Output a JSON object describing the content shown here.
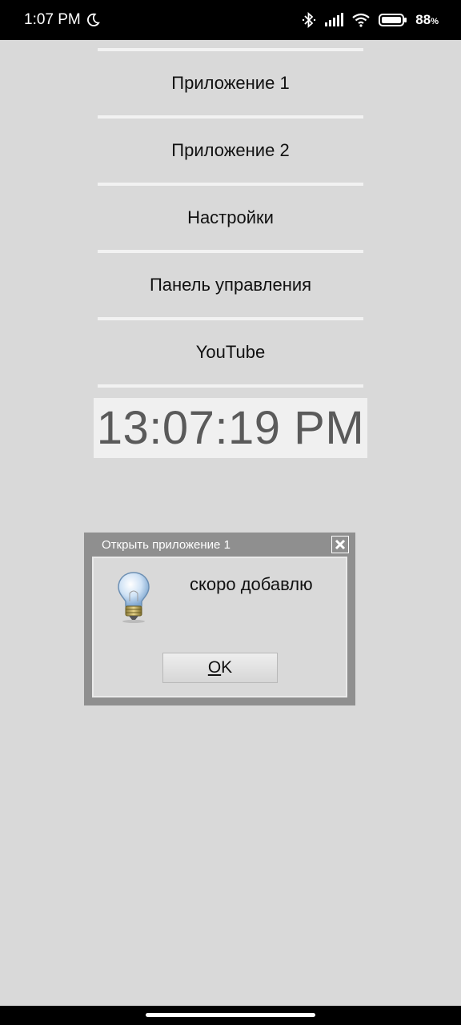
{
  "status_bar": {
    "time": "1:07 PM",
    "battery_percent": "88",
    "battery_unit": "%",
    "icons": [
      "moon-icon",
      "bluetooth-icon",
      "signal-icon",
      "wifi-icon",
      "battery-icon"
    ]
  },
  "menu": {
    "items": [
      {
        "label": "Приложение 1"
      },
      {
        "label": "Приложение 2"
      },
      {
        "label": "Настройки"
      },
      {
        "label": "Панель управления"
      },
      {
        "label": "YouTube"
      }
    ]
  },
  "clock": {
    "time": "13:07:19 PM"
  },
  "dialog": {
    "title": "Открыть приложение 1",
    "message": "скоро добавлю",
    "ok_mnemonic": "O",
    "ok_rest": "K",
    "icon": "lightbulb-icon"
  },
  "colors": {
    "background": "#d9d9d9",
    "dialog_frame": "#8f8f8f",
    "clock_text": "#5a5a5a"
  }
}
